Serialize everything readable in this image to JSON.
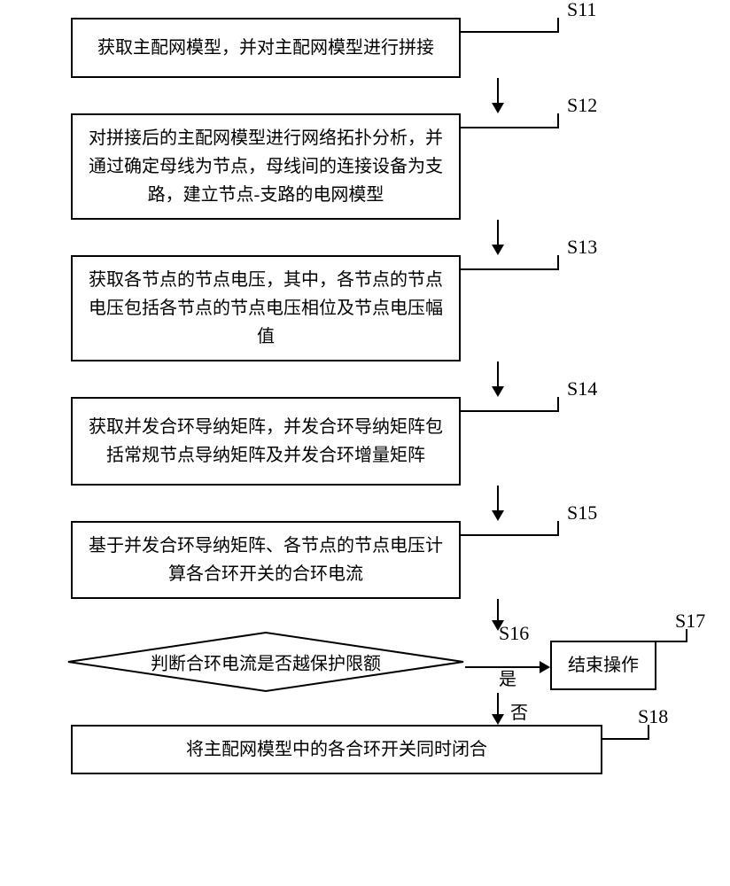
{
  "steps": {
    "s11": {
      "id": "S11",
      "text": "获取主配网模型，并对主配网模型进行拼接"
    },
    "s12": {
      "id": "S12",
      "text": "对拼接后的主配网模型进行网络拓扑分析，并通过确定母线为节点，母线间的连接设备为支路，建立节点-支路的电网模型"
    },
    "s13": {
      "id": "S13",
      "text": "获取各节点的节点电压，其中，各节点的节点电压包括各节点的节点电压相位及节点电压幅值"
    },
    "s14": {
      "id": "S14",
      "text": "获取并发合环导纳矩阵，并发合环导纳矩阵包括常规节点导纳矩阵及并发合环增量矩阵"
    },
    "s15": {
      "id": "S15",
      "text": "基于并发合环导纳矩阵、各节点的节点电压计算各合环开关的合环电流"
    },
    "s16": {
      "id": "S16",
      "text": "判断合环电流是否越保护限额"
    },
    "s17": {
      "id": "S17",
      "text": "结束操作"
    },
    "s18": {
      "id": "S18",
      "text": "将主配网模型中的各合环开关同时闭合"
    }
  },
  "branches": {
    "yes": "是",
    "no": "否"
  }
}
